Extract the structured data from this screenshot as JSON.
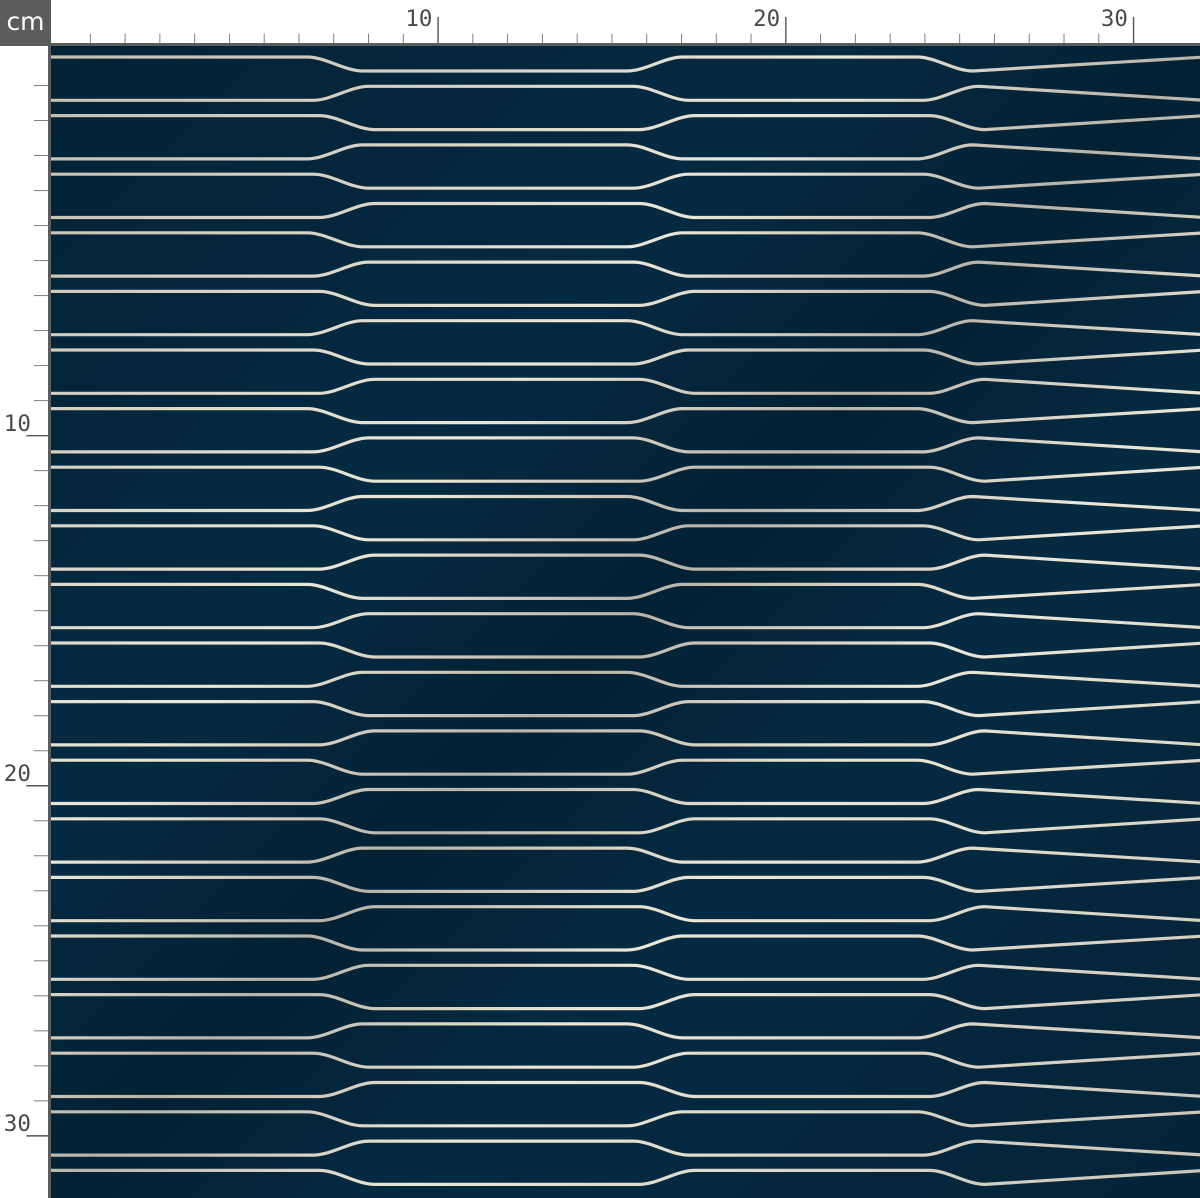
{
  "ruler": {
    "unit": "cm",
    "top_labels": [
      "10",
      "20",
      "30"
    ],
    "left_labels": [
      "10",
      "20",
      "30"
    ]
  },
  "fabric": {
    "background_color": "#042a42",
    "line_color": "#ece6d6",
    "motif": "wavy horizontal hand-drawn lines"
  }
}
